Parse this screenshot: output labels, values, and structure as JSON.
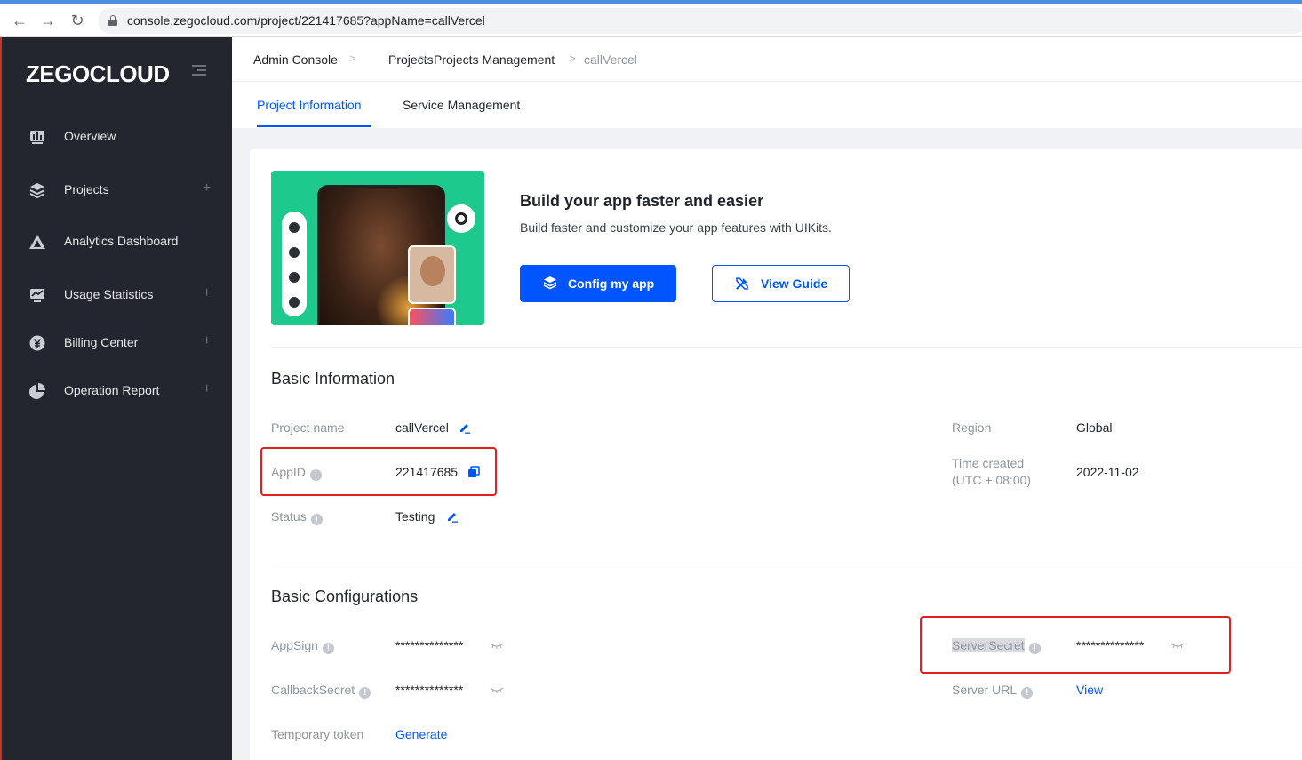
{
  "browser": {
    "url": "console.zegocloud.com/project/221417685?appName=callVercel",
    "back_glyph": "←",
    "forward_glyph": "→",
    "reload_glyph": "↻"
  },
  "sidebar": {
    "logo": "ZEGOCLOUD",
    "items": [
      {
        "label": "Overview",
        "icon": "dashboard-icon",
        "expandable": false
      },
      {
        "label": "Projects",
        "icon": "layers-icon",
        "expandable": true
      },
      {
        "label": "Analytics Dashboard",
        "icon": "triangle-chart-icon",
        "expandable": false
      },
      {
        "label": "Usage Statistics",
        "icon": "monitor-chart-icon",
        "expandable": true
      },
      {
        "label": "Billing Center",
        "icon": "yen-coin-icon",
        "expandable": true
      },
      {
        "label": "Operation Report",
        "icon": "pie-chart-icon",
        "expandable": true
      }
    ],
    "plus_glyph": "+"
  },
  "breadcrumb": {
    "items": [
      "Admin Console",
      "Projects",
      "Projects Management",
      "callVercel"
    ],
    "separator": ">"
  },
  "tabs": {
    "items": [
      "Project Information",
      "Service Management"
    ],
    "active_index": 0
  },
  "promo": {
    "title": "Build your app faster and easier",
    "subtitle": "Build faster and customize your app features with UIKits.",
    "primary_button": "Config my app",
    "secondary_button": "View Guide"
  },
  "basic_info": {
    "title": "Basic Information",
    "project_name_label": "Project name",
    "project_name_value": "callVercel",
    "appid_label": "AppID",
    "appid_value": "221417685",
    "status_label": "Status",
    "status_value": "Testing",
    "region_label": "Region",
    "region_value": "Global",
    "time_created_label": "Time created",
    "time_created_tz": "(UTC + 08:00)",
    "time_created_value": "2022-11-02"
  },
  "basic_config": {
    "title": "Basic Configurations",
    "appsign_label": "AppSign",
    "appsign_value": "**************",
    "callback_label": "CallbackSecret",
    "callback_value": "**************",
    "temp_token_label": "Temporary token",
    "temp_token_action": "Generate",
    "server_secret_label": "ServerSecret",
    "server_secret_value": "**************",
    "server_url_label": "Server URL",
    "server_url_action": "View"
  },
  "colors": {
    "accent": "#0055ff",
    "sidebar_bg": "#23262e",
    "highlight_border": "#e02020",
    "banner_bg": "#1ec98e"
  }
}
